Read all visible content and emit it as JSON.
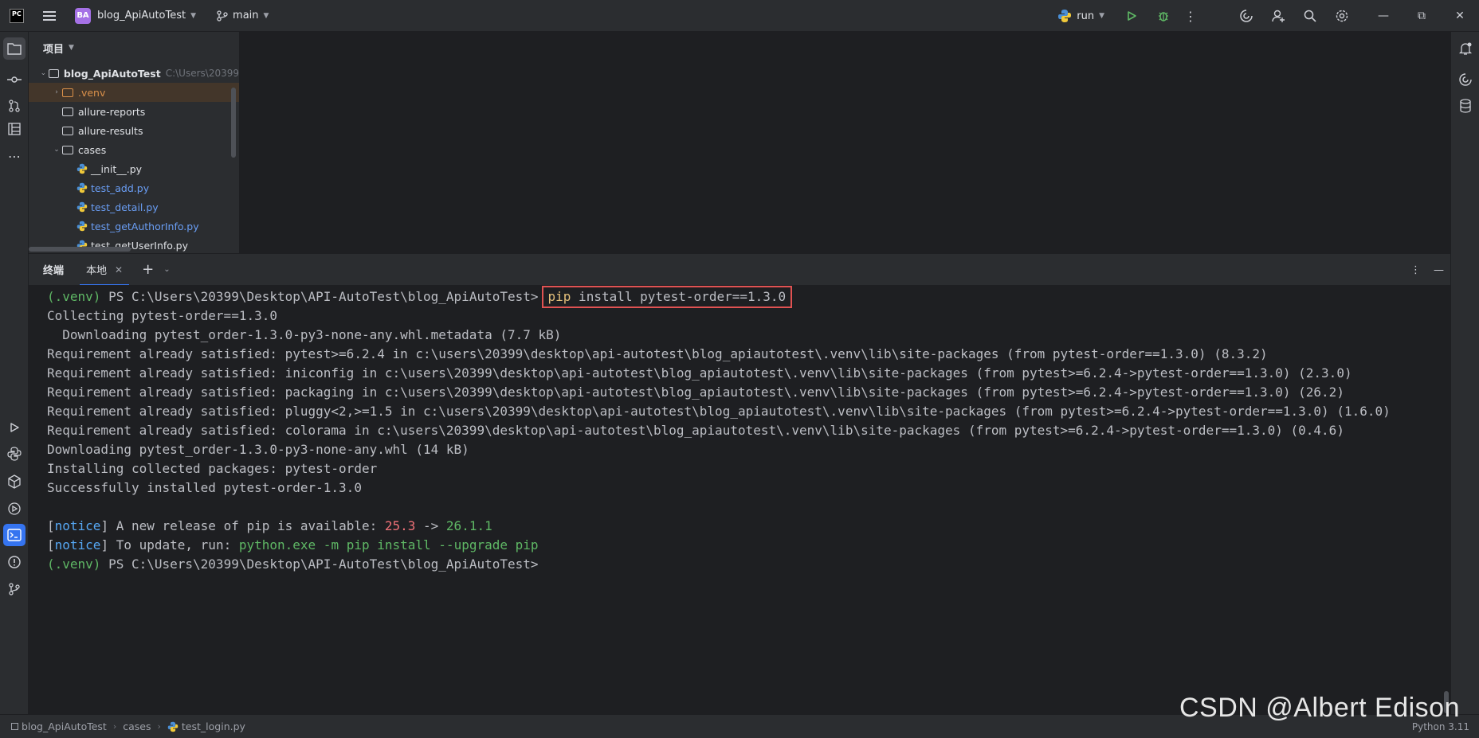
{
  "titlebar": {
    "app_logo_text": "PC",
    "project_badge": "BA",
    "project_name": "blog_ApiAutoTest",
    "branch": "main",
    "run_config": "run"
  },
  "project_panel": {
    "title": "项目",
    "tree": [
      {
        "label": "blog_ApiAutoTest",
        "path": "C:\\Users\\20399",
        "type": "folder",
        "expanded": true,
        "depth": 0
      },
      {
        "label": ".venv",
        "type": "folder",
        "expanded": false,
        "depth": 1,
        "color": "orange"
      },
      {
        "label": "allure-reports",
        "type": "folder",
        "depth": 1
      },
      {
        "label": "allure-results",
        "type": "folder",
        "depth": 1
      },
      {
        "label": "cases",
        "type": "folder",
        "expanded": true,
        "depth": 1
      },
      {
        "label": "__init__.py",
        "type": "py",
        "depth": 2
      },
      {
        "label": "test_add.py",
        "type": "py",
        "depth": 2,
        "color": "blue"
      },
      {
        "label": "test_detail.py",
        "type": "py",
        "depth": 2,
        "color": "blue"
      },
      {
        "label": "test_getAuthorInfo.py",
        "type": "py",
        "depth": 2,
        "color": "blue"
      },
      {
        "label": "test_getUserInfo.py",
        "type": "py",
        "depth": 2
      }
    ]
  },
  "terminal": {
    "title": "终端",
    "tab": "本地",
    "prompt_venv": "(.venv)",
    "prompt_path": " PS C:\\Users\\20399\\Desktop\\API-AutoTest\\blog_ApiAutoTest>",
    "cmd_pip": "pip",
    "cmd_rest": " install pytest-order==1.3.0",
    "lines": [
      "Collecting pytest-order==1.3.0",
      "  Downloading pytest_order-1.3.0-py3-none-any.whl.metadata (7.7 kB)",
      "Requirement already satisfied: pytest>=6.2.4 in c:\\users\\20399\\desktop\\api-autotest\\blog_apiautotest\\.venv\\lib\\site-packages (from pytest-order==1.3.0) (8.3.2)",
      "Requirement already satisfied: iniconfig in c:\\users\\20399\\desktop\\api-autotest\\blog_apiautotest\\.venv\\lib\\site-packages (from pytest>=6.2.4->pytest-order==1.3.0) (2.3.0)",
      "Requirement already satisfied: packaging in c:\\users\\20399\\desktop\\api-autotest\\blog_apiautotest\\.venv\\lib\\site-packages (from pytest>=6.2.4->pytest-order==1.3.0) (26.2)",
      "Requirement already satisfied: pluggy<2,>=1.5 in c:\\users\\20399\\desktop\\api-autotest\\blog_apiautotest\\.venv\\lib\\site-packages (from pytest>=6.2.4->pytest-order==1.3.0) (1.6.0)",
      "Requirement already satisfied: colorama in c:\\users\\20399\\desktop\\api-autotest\\blog_apiautotest\\.venv\\lib\\site-packages (from pytest>=6.2.4->pytest-order==1.3.0) (0.4.6)",
      "Downloading pytest_order-1.3.0-py3-none-any.whl (14 kB)",
      "Installing collected packages: pytest-order",
      "Successfully installed pytest-order-1.3.0"
    ],
    "notice1": {
      "open": "[",
      "tag": "notice",
      "close": "]",
      "text": " A new release of pip is available: ",
      "old": "25.3",
      "arrow": " -> ",
      "new": "26.1.1"
    },
    "notice2": {
      "open": "[",
      "tag": "notice",
      "close": "]",
      "text": " To update, run: ",
      "cmd": "python.exe -m pip install --upgrade pip"
    }
  },
  "statusbar": {
    "crumbs": [
      "blog_ApiAutoTest",
      "cases",
      "test_login.py"
    ],
    "interpreter": "Python 3.11"
  },
  "watermark": "CSDN @Albert Edison",
  "colors": {
    "accent": "#3574f0",
    "highlight_box": "#e05252",
    "prompt_green": "#5fb865"
  }
}
